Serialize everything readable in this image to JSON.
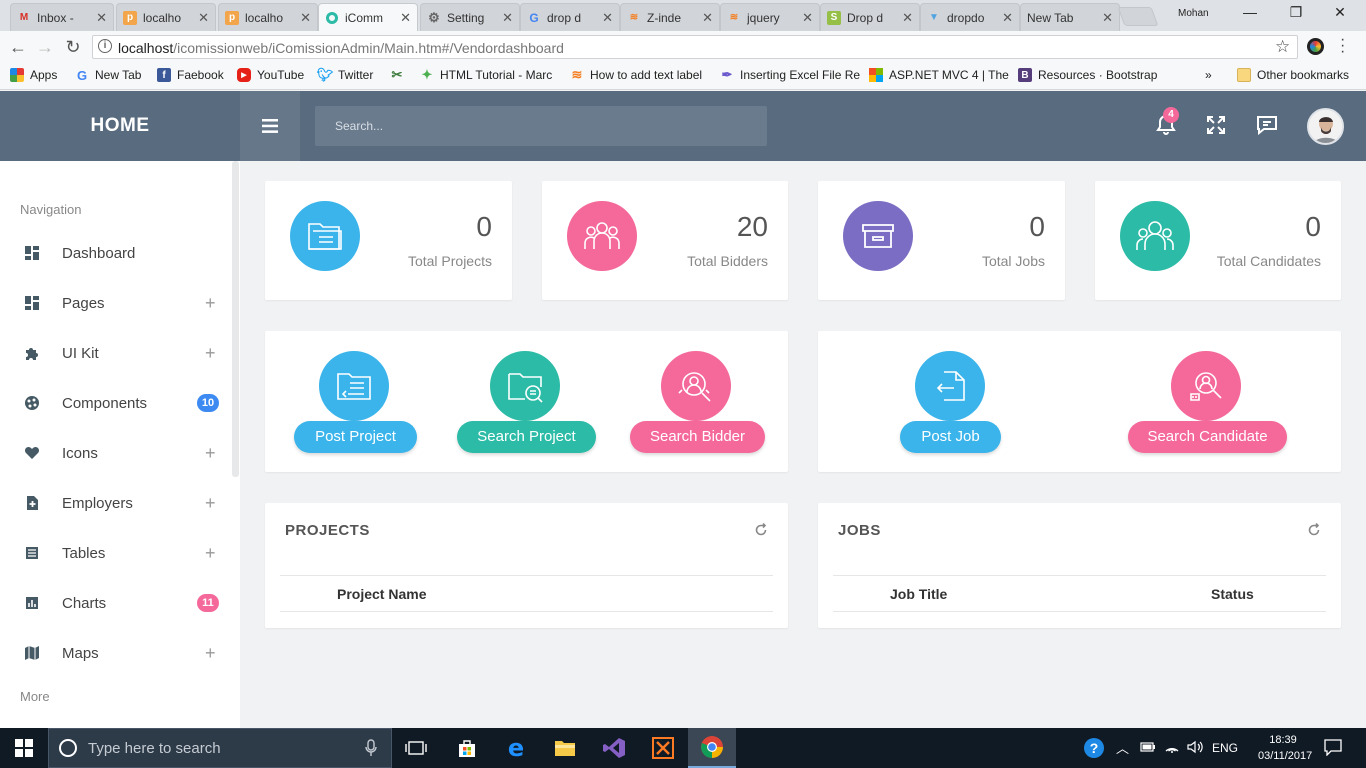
{
  "browser": {
    "tabs": [
      {
        "title": "Inbox -",
        "favicon": "gmail-icon",
        "active": false
      },
      {
        "title": "localho",
        "favicon": "phpmyadmin-icon",
        "active": false
      },
      {
        "title": "localho",
        "favicon": "phpmyadmin-icon",
        "active": false
      },
      {
        "title": "iComm",
        "favicon": "circle-icon",
        "active": true
      },
      {
        "title": "Setting",
        "favicon": "gear-icon",
        "active": false
      },
      {
        "title": "drop d",
        "favicon": "google-icon",
        "active": false
      },
      {
        "title": "Z-inde",
        "favicon": "stackoverflow-icon",
        "active": false
      },
      {
        "title": "jquery",
        "favicon": "stackoverflow-icon",
        "active": false
      },
      {
        "title": "Drop d",
        "favicon": "shopify-icon",
        "active": false
      },
      {
        "title": "dropdo",
        "favicon": "triangle-icon",
        "active": false
      },
      {
        "title": "New Tab",
        "favicon": "",
        "active": false
      }
    ],
    "profile": "Mohan",
    "url_host": "localhost",
    "url_path": "/icomissionweb/iComissionAdmin/Main.htm#/Vendordashboard",
    "bookmarks": [
      {
        "label": "Apps",
        "icon": "apps-icon",
        "color": "#e53935"
      },
      {
        "label": "New Tab",
        "icon": "google-icon",
        "color": "#4285f4"
      },
      {
        "label": "Faebook",
        "icon": "facebook-icon",
        "color": "#3b5998"
      },
      {
        "label": "YouTube",
        "icon": "youtube-icon",
        "color": "#e62117"
      },
      {
        "label": "Twitter",
        "icon": "twitter-icon",
        "color": "#1da1f2"
      },
      {
        "label": "",
        "icon": "bookmark-icon",
        "color": "#3b7a3b"
      },
      {
        "label": "HTML Tutorial - Marc",
        "icon": "tree-icon",
        "color": "#4caf50"
      },
      {
        "label": "How to add text label",
        "icon": "stackoverflow-icon",
        "color": "#f48024"
      },
      {
        "label": "Inserting Excel File Re",
        "icon": "pen-icon",
        "color": "#6a5acd"
      },
      {
        "label": "ASP.NET MVC 4 | The",
        "icon": "windows-icon",
        "color": "#f25022"
      },
      {
        "label": "Resources · Bootstrap",
        "icon": "bootstrap-icon",
        "color": "#563d7c"
      }
    ],
    "overflow": "»",
    "other_bookmarks": "Other bookmarks"
  },
  "header": {
    "brand": "HOME",
    "search_placeholder": "Search...",
    "notification_count": "4"
  },
  "sidebar": {
    "heading": "Navigation",
    "footer_heading": "More",
    "items": [
      {
        "label": "Dashboard",
        "icon": "dashboard-icon",
        "expand": false
      },
      {
        "label": "Pages",
        "icon": "pages-icon",
        "expand": true
      },
      {
        "label": "UI Kit",
        "icon": "puzzle-icon",
        "expand": true
      },
      {
        "label": "Components",
        "icon": "palette-icon",
        "expand": false,
        "badge": "10",
        "badge_color": "#3d8bf2"
      },
      {
        "label": "Icons",
        "icon": "heart-icon",
        "expand": true
      },
      {
        "label": "Employers",
        "icon": "file-plus-icon",
        "expand": true
      },
      {
        "label": "Tables",
        "icon": "table-icon",
        "expand": true
      },
      {
        "label": "Charts",
        "icon": "chart-icon",
        "expand": false,
        "badge": "11",
        "badge_color": "#f4689a"
      },
      {
        "label": "Maps",
        "icon": "map-icon",
        "expand": true
      }
    ]
  },
  "stats": [
    {
      "value": "0",
      "label": "Total Projects",
      "color": "#3ab4ea",
      "icon": "folder-icon"
    },
    {
      "value": "20",
      "label": "Total Bidders",
      "color": "#f4689a",
      "icon": "group-icon"
    },
    {
      "value": "0",
      "label": "Total Jobs",
      "color": "#7b6cc4",
      "icon": "inbox-icon"
    },
    {
      "value": "0",
      "label": "Total Candidates",
      "color": "#2cbba6",
      "icon": "people-icon"
    }
  ],
  "actions": [
    {
      "label": "Post Project",
      "color": "#3ab4ea",
      "icon": "folder-send-icon"
    },
    {
      "label": "Search Project",
      "color": "#2cbba6",
      "icon": "folder-search-icon"
    },
    {
      "label": "Search Bidder",
      "color": "#f4689a",
      "icon": "user-search-icon"
    },
    {
      "label": "Post Job",
      "color": "#3ab4ea",
      "icon": "file-send-icon"
    },
    {
      "label": "Search Candidate",
      "color": "#f4689a",
      "icon": "candidate-search-icon"
    }
  ],
  "projects_panel": {
    "title": "PROJECTS",
    "columns": [
      "Project Name"
    ]
  },
  "jobs_panel": {
    "title": "JOBS",
    "columns": [
      "Job Title",
      "Status"
    ]
  },
  "taskbar": {
    "search_placeholder": "Type here to search",
    "language": "ENG",
    "time": "18:39",
    "date": "03/11/2017"
  }
}
